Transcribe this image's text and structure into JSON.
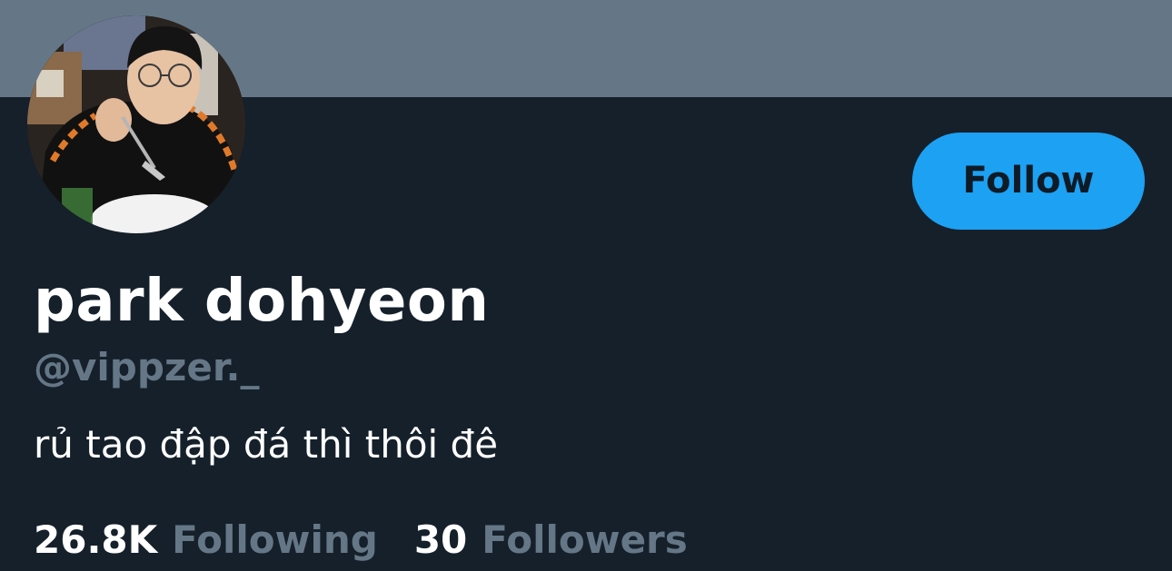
{
  "profile": {
    "display_name": "park dohyeon",
    "handle": "@vippzer._",
    "bio": "rủ tao đập đá thì thôi đê",
    "follow_label": "Follow",
    "avatar_description": "profile photo"
  },
  "stats": {
    "following_count": "26.8K",
    "following_label": "Following",
    "followers_count": "30",
    "followers_label": "Followers"
  },
  "colors": {
    "background": "#15202b",
    "banner": "#657786",
    "accent": "#1da1f2",
    "secondary_text": "#657786",
    "primary_text": "#ffffff"
  }
}
